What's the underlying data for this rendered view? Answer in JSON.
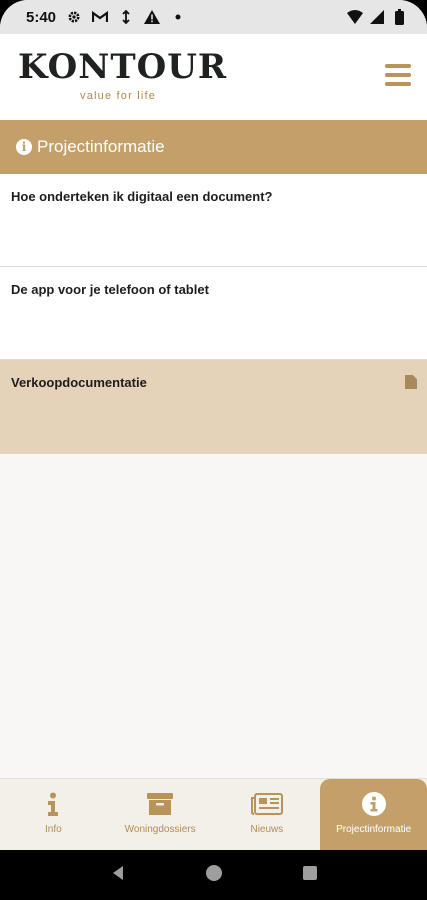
{
  "status_bar": {
    "time": "5:40",
    "left_icons": [
      "gear-icon",
      "gmail-icon",
      "data-saver-icon",
      "warning-icon",
      "dot-icon"
    ],
    "right_icons": [
      "wifi-icon",
      "signal-icon",
      "battery-icon"
    ]
  },
  "header": {
    "logo_text": "KONTOUR",
    "logo_tagline": "value for life",
    "menu_icon": "hamburger-icon"
  },
  "section": {
    "icon": "info-circle-icon",
    "icon_glyph": "i",
    "title": "Projectinformatie"
  },
  "list": {
    "items": [
      {
        "label": "Hoe onderteken ik digitaal een document?"
      },
      {
        "label": "De app voor je telefoon of tablet"
      },
      {
        "label": "Verkoopdocumentatie",
        "icon": "document-icon"
      }
    ]
  },
  "bottom_nav": {
    "items": [
      {
        "label": "Info",
        "icon": "info-icon"
      },
      {
        "label": "Woningdossiers",
        "icon": "archive-box-icon"
      },
      {
        "label": "Nieuws",
        "icon": "newspaper-icon"
      },
      {
        "label": "Projectinformatie",
        "icon": "info-circle-icon",
        "active": true
      }
    ]
  },
  "colors": {
    "accent": "#c3a06a",
    "highlight_row": "#e5d3b9",
    "nav_background": "#f3efe9",
    "logo": "#1f2320"
  }
}
